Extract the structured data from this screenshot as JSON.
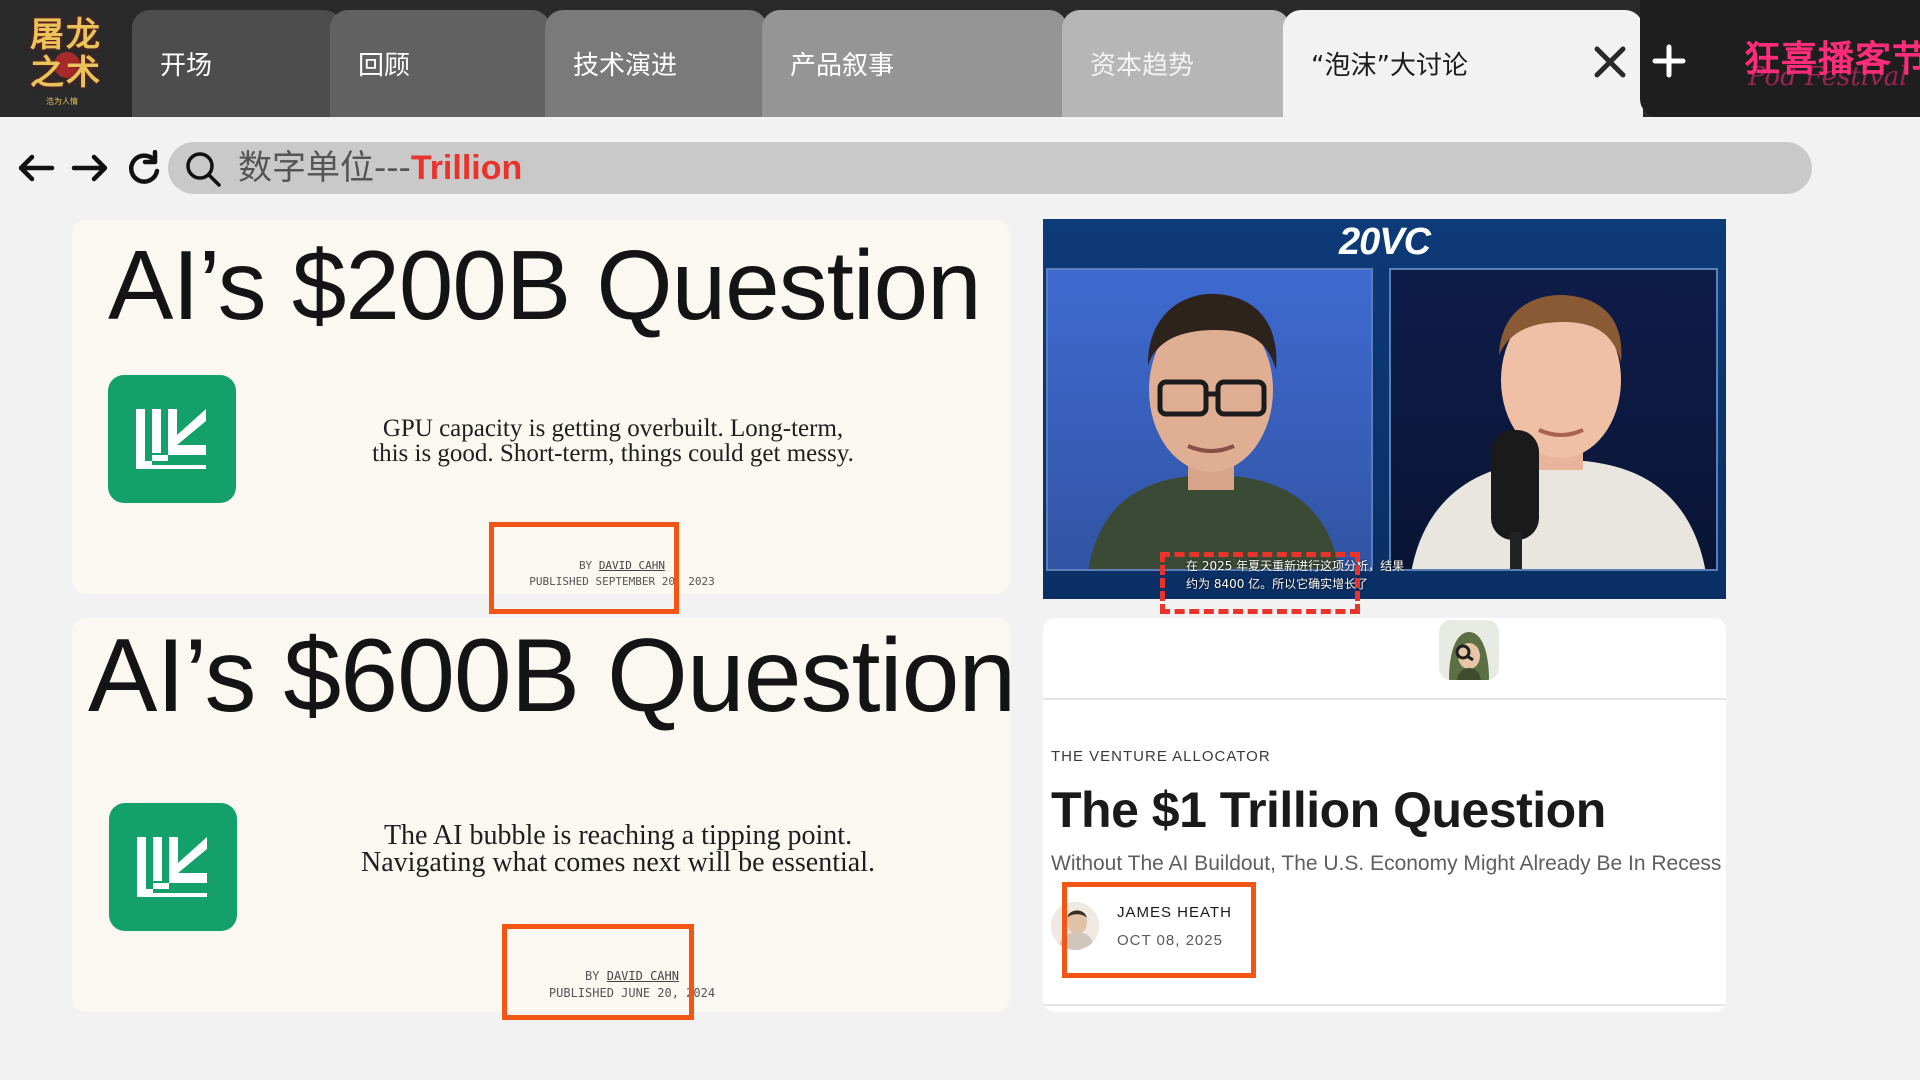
{
  "logo": {
    "text_line1": "屠龙",
    "text_line2": "之术",
    "sub": "浩为人情"
  },
  "tabs": [
    {
      "label": "开场"
    },
    {
      "label": "回顾"
    },
    {
      "label": "技术演进"
    },
    {
      "label": "产品叙事"
    },
    {
      "label": "资本趋势"
    },
    {
      "label": "“泡沫”大讨论",
      "active": true
    }
  ],
  "brand": {
    "title": "狂喜播客节",
    "script": "Pod Festival"
  },
  "toolbar": {
    "back_icon": "arrow-left-icon",
    "forward_icon": "arrow-right-icon",
    "reload_icon": "reload-icon"
  },
  "search": {
    "prefix": "数字单位---",
    "highlight": "Trillion"
  },
  "cards": [
    {
      "title": "AI’s $200B Question",
      "desc_line1": "GPU capacity is getting overbuilt. Long-term,",
      "desc_line2": "this is good. Short-term, things could get messy.",
      "by_prefix": "BY ",
      "author": "DAVID CAHN",
      "published": "PUBLISHED SEPTEMBER 20, 2023"
    },
    {
      "title": "AI’s $600B Question",
      "desc_line1": "The AI bubble is reaching a tipping point.",
      "desc_line2": "Navigating what comes next will be essential.",
      "by_prefix": "BY ",
      "author": "DAVID CAHN",
      "published": "PUBLISHED JUNE 20, 2024"
    }
  ],
  "video": {
    "title": "20VC",
    "subtitle_line1": "在 2025 年夏天重新进行这项分析，结果",
    "subtitle_line2": "约为 8400 亿。所以它确实增长了"
  },
  "article": {
    "kicker": "THE VENTURE ALLOCATOR",
    "title": "The $1 Trillion Question",
    "subtitle": "Without The AI Buildout, The U.S. Economy Might Already Be In Recess",
    "author": "JAMES HEATH",
    "date": "OCT 08, 2025"
  },
  "colors": {
    "accent_red": "#e8342a",
    "box_orange": "#f25514",
    "brand_pink": "#ff2d79",
    "logo_green": "#14a06a"
  }
}
